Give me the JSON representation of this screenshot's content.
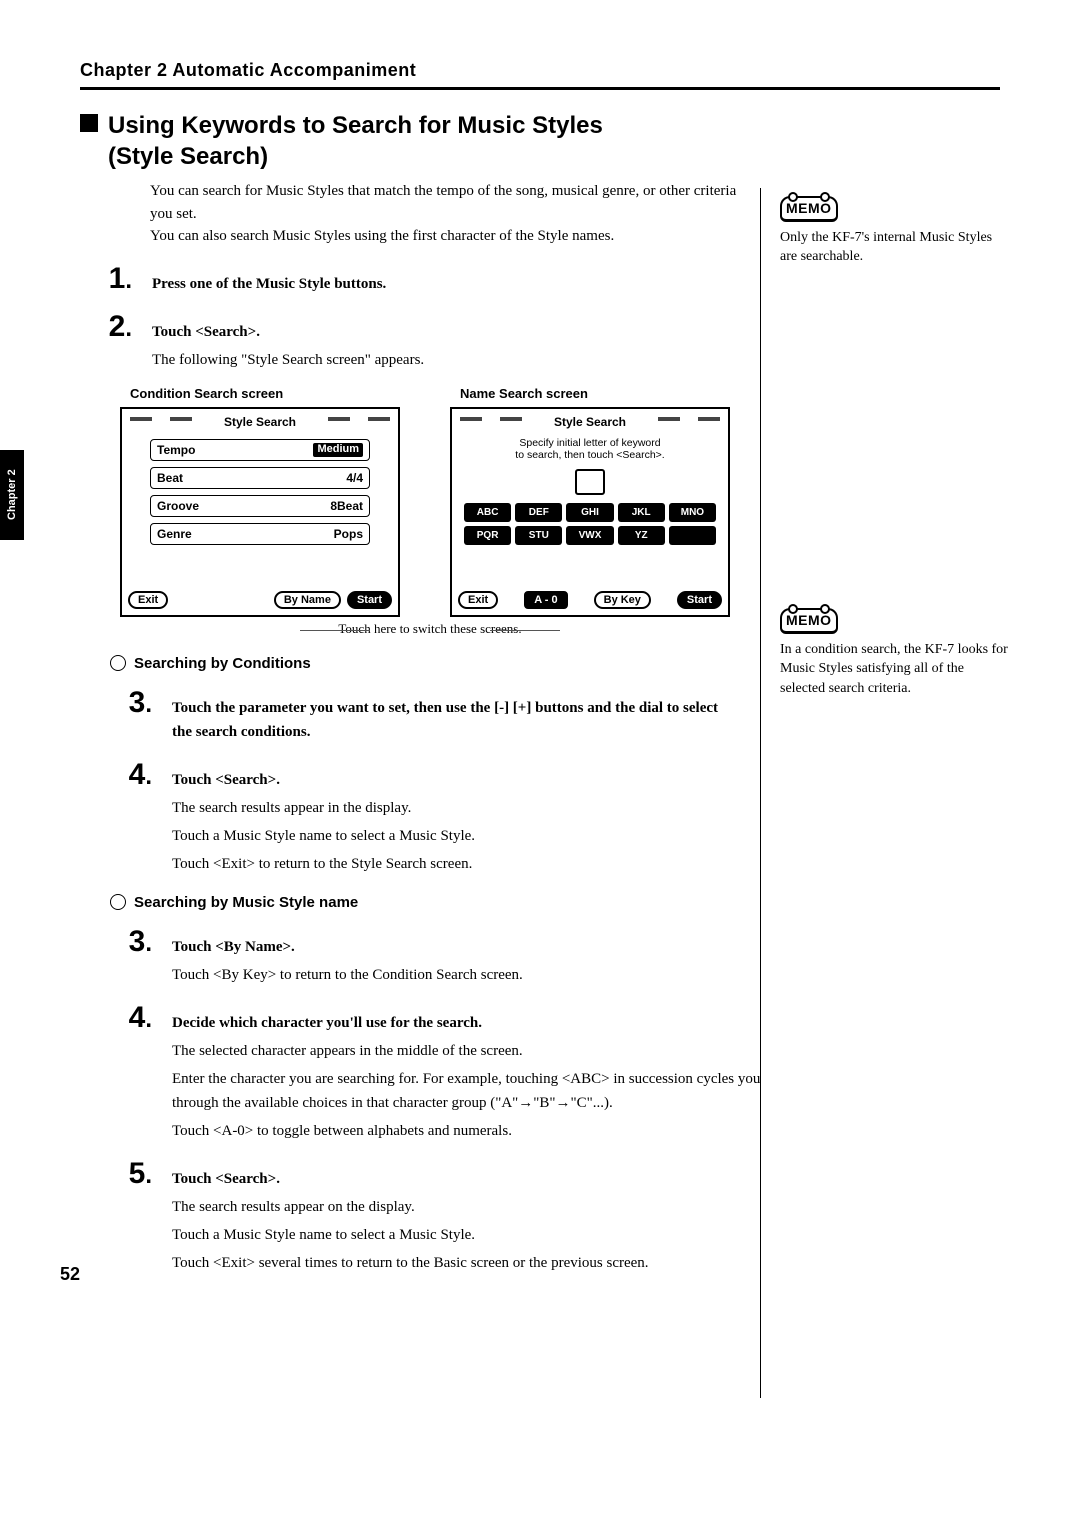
{
  "chapter_header": "Chapter 2 Automatic Accompaniment",
  "side_tab": "Chapter 2",
  "page_number": "52",
  "section_title_line1": "Using Keywords to Search for Music Styles",
  "section_title_line2": "(Style Search)",
  "intro_p1": "You can search for Music Styles that match the tempo of the song, musical genre, or other criteria you set.",
  "intro_p2": "You can also search Music Styles using the first character of the Style names.",
  "step1": {
    "num": "1",
    "text": "Press one of the Music Style buttons."
  },
  "step2": {
    "num": "2",
    "text": "Touch <Search>."
  },
  "step2_body": "The following \"Style Search screen\" appears.",
  "screens": {
    "condition_label": "Condition Search screen",
    "name_label": "Name Search screen",
    "lcd_title": "Style Search",
    "params": [
      {
        "label": "Tempo",
        "value": "Medium"
      },
      {
        "label": "Beat",
        "value": "4/4"
      },
      {
        "label": "Groove",
        "value": "8Beat"
      },
      {
        "label": "Genre",
        "value": "Pops"
      }
    ],
    "cond_bottom": {
      "exit": "Exit",
      "byname": "By Name",
      "start": "Start"
    },
    "name_instr_l1": "Specify initial letter of keyword",
    "name_instr_l2": "to search, then touch <Search>.",
    "abc_row1": [
      "ABC",
      "DEF",
      "GHI",
      "JKL",
      "MNO"
    ],
    "abc_row2": [
      "PQR",
      "STU",
      "VWX",
      "YZ",
      ""
    ],
    "name_bottom": {
      "exit": "Exit",
      "a0": "A - 0",
      "bykey": "By Key",
      "start": "Start"
    },
    "switch_note": "Touch here to switch these screens."
  },
  "sub_a_title": "Searching by Conditions",
  "step3a": {
    "num": "3",
    "text": "Touch the parameter you want to set, then use the [-] [+] buttons and the dial to select the search conditions."
  },
  "step4a": {
    "num": "4",
    "text": "Touch <Search>."
  },
  "step4a_body1": "The search results appear in the display.",
  "step4a_body2": "Touch a Music Style name to select a Music Style.",
  "step4a_body3": "Touch <Exit> to return to the Style Search screen.",
  "sub_b_title": "Searching by Music Style name",
  "step3b": {
    "num": "3",
    "text": "Touch <By Name>."
  },
  "step3b_body": "Touch <By Key> to return to the Condition Search screen.",
  "step4b": {
    "num": "4",
    "text": "Decide which character you'll use for the search."
  },
  "step4b_body1": "The selected character appears in the middle of the screen.",
  "step4b_body2": "Enter the character you are searching for. For example, touching <ABC> in succession cycles you through the available choices in that character group (\"A\"→\"B\"→\"C\"...).",
  "step4b_body3": "Touch <A-0> to toggle between alphabets and numerals.",
  "step5": {
    "num": "5",
    "text": "Touch <Search>."
  },
  "step5_body1": "The search results appear on the display.",
  "step5_body2": "Touch a Music Style name to select a Music Style.",
  "step5_body3": "Touch <Exit> several times to return to the Basic screen or the previous screen.",
  "memo1": {
    "label": "MEMO",
    "text": "Only the KF-7's internal Music Styles are searchable."
  },
  "memo2": {
    "label": "MEMO",
    "text": "In a condition search, the KF-7 looks for Music Styles satisfying all of the selected search criteria."
  }
}
